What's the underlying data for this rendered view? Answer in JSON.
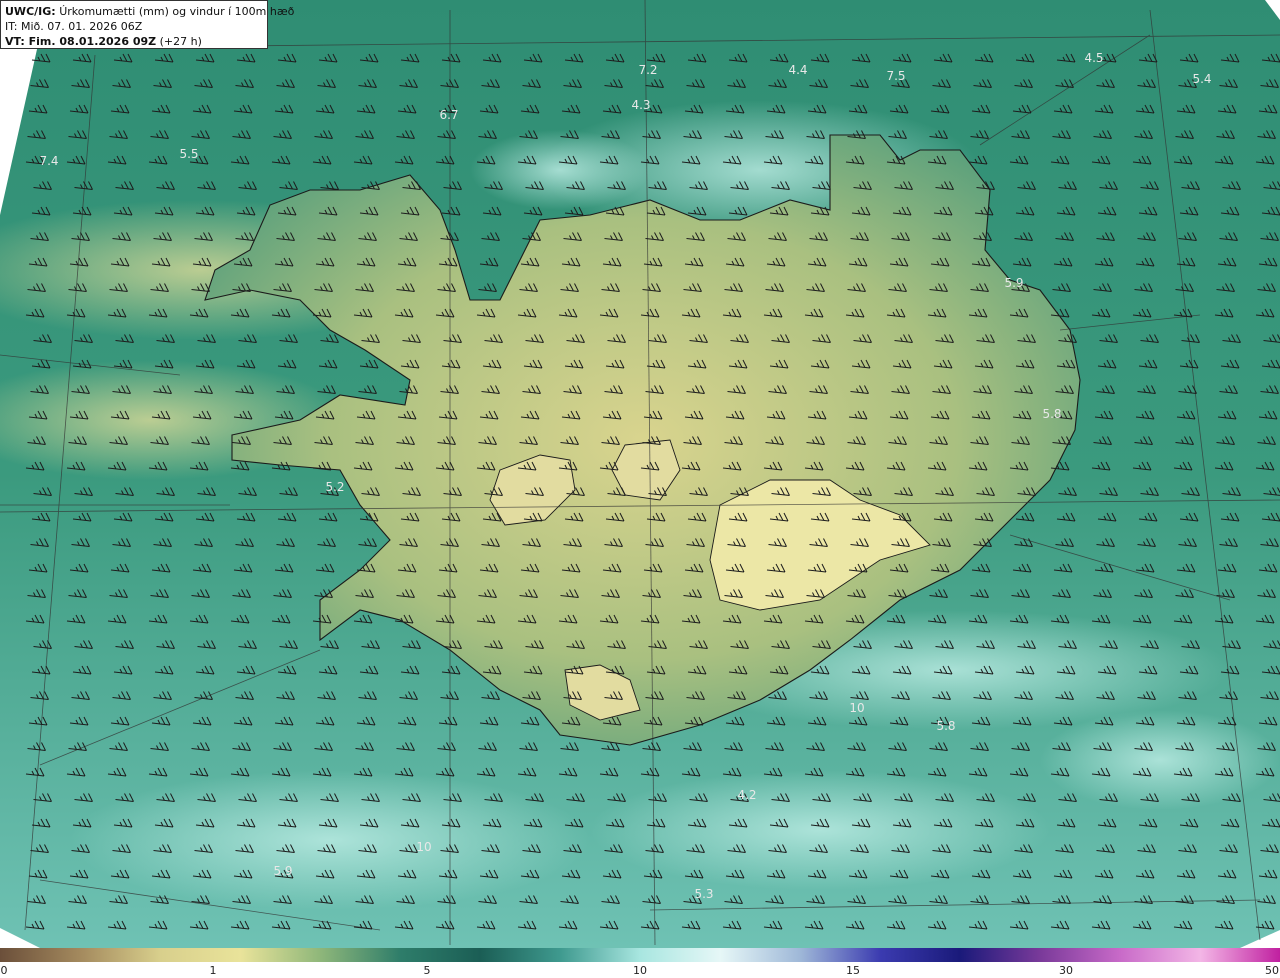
{
  "header": {
    "product_code": "UWC/IG:",
    "product_title": "Úrkomumætti (mm) og vindur í 100m hæð",
    "init_time": "IT: Mið. 07. 01. 2026 06Z",
    "valid_time_label": "VT: Fim. 08.01.2026 09Z",
    "lead_time": "(+27 h)"
  },
  "map_labels": [
    "7.2",
    "4.4",
    "7.5",
    "4.5",
    "5.4",
    "4.3",
    "6.7",
    "5.5",
    "7.4",
    "5.9",
    "5.8",
    "5.2",
    "5.8",
    "4.2",
    "10",
    "5.9",
    "5.3",
    "10"
  ],
  "colorbar": {
    "ticks": [
      "0",
      "1",
      "5",
      "10",
      "15",
      "30",
      "50"
    ],
    "colors": [
      "#6b4f3a",
      "#a48a5e",
      "#d8cf8c",
      "#e9e39a",
      "#8fb77a",
      "#2e7d6a",
      "#1b5e55",
      "#3f9a8f",
      "#a8e6e0",
      "#e6f7f7",
      "#9fb8d8",
      "#3b3bb0",
      "#1a1a7a",
      "#7a3a9a",
      "#c86ac8",
      "#f3b6e6",
      "#c020a0"
    ]
  }
}
